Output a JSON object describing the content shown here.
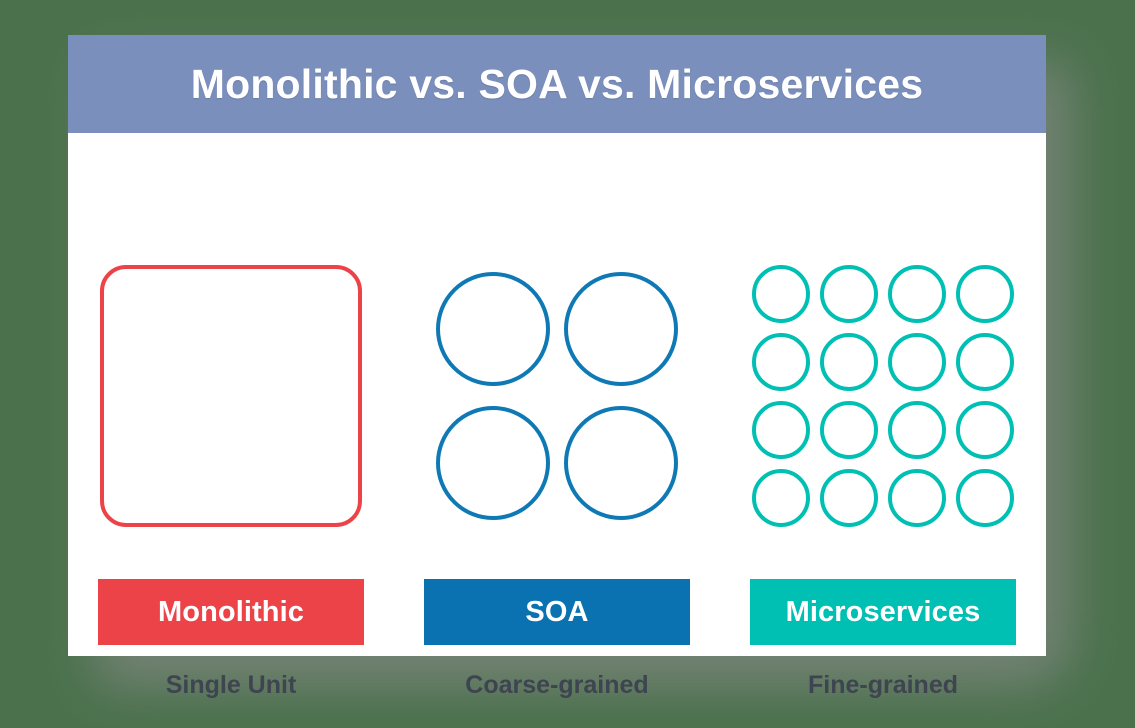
{
  "background_color": "#4a714c",
  "card": {
    "background_color": "#ffffff",
    "header": {
      "title": "Monolithic vs. SOA vs. Microservices",
      "background_color": "#7b8fbc",
      "text_color": "#ffffff"
    }
  },
  "columns": [
    {
      "id": "monolithic",
      "shape": "rounded-square",
      "shape_count": 1,
      "shape_color": "#ec4349",
      "label": "Monolithic",
      "label_bar_color": "#ec4349",
      "sublabel": "Single Unit"
    },
    {
      "id": "soa",
      "shape": "circle",
      "shape_count": 4,
      "grid": "2x2",
      "shape_color": "#0f79b5",
      "label": "SOA",
      "label_bar_color": "#0b72b2",
      "sublabel": "Coarse-grained"
    },
    {
      "id": "microservices",
      "shape": "circle",
      "shape_count": 16,
      "grid": "4x4",
      "shape_color": "#00bfb3",
      "label": "Microservices",
      "label_bar_color": "#00bfb3",
      "sublabel": "Fine-grained"
    }
  ],
  "sublabel_text_color": "#3e4450"
}
